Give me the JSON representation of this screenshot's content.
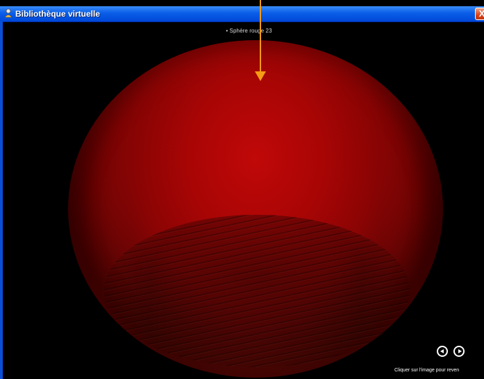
{
  "window": {
    "title": "Bibliothèque virtuelle",
    "close_label": "X"
  },
  "viewer": {
    "caption": "• Sphère rouge 23",
    "hint": "Cliquer sur l'image pour reven"
  },
  "colors": {
    "titlebar": "#0a5ee8",
    "sphere": "#b00606",
    "arrow": "#f59a14",
    "background": "#000000"
  },
  "icons": {
    "app": "library-icon",
    "prev": "previous-circle-icon",
    "next": "next-circle-icon",
    "close": "close-icon"
  }
}
